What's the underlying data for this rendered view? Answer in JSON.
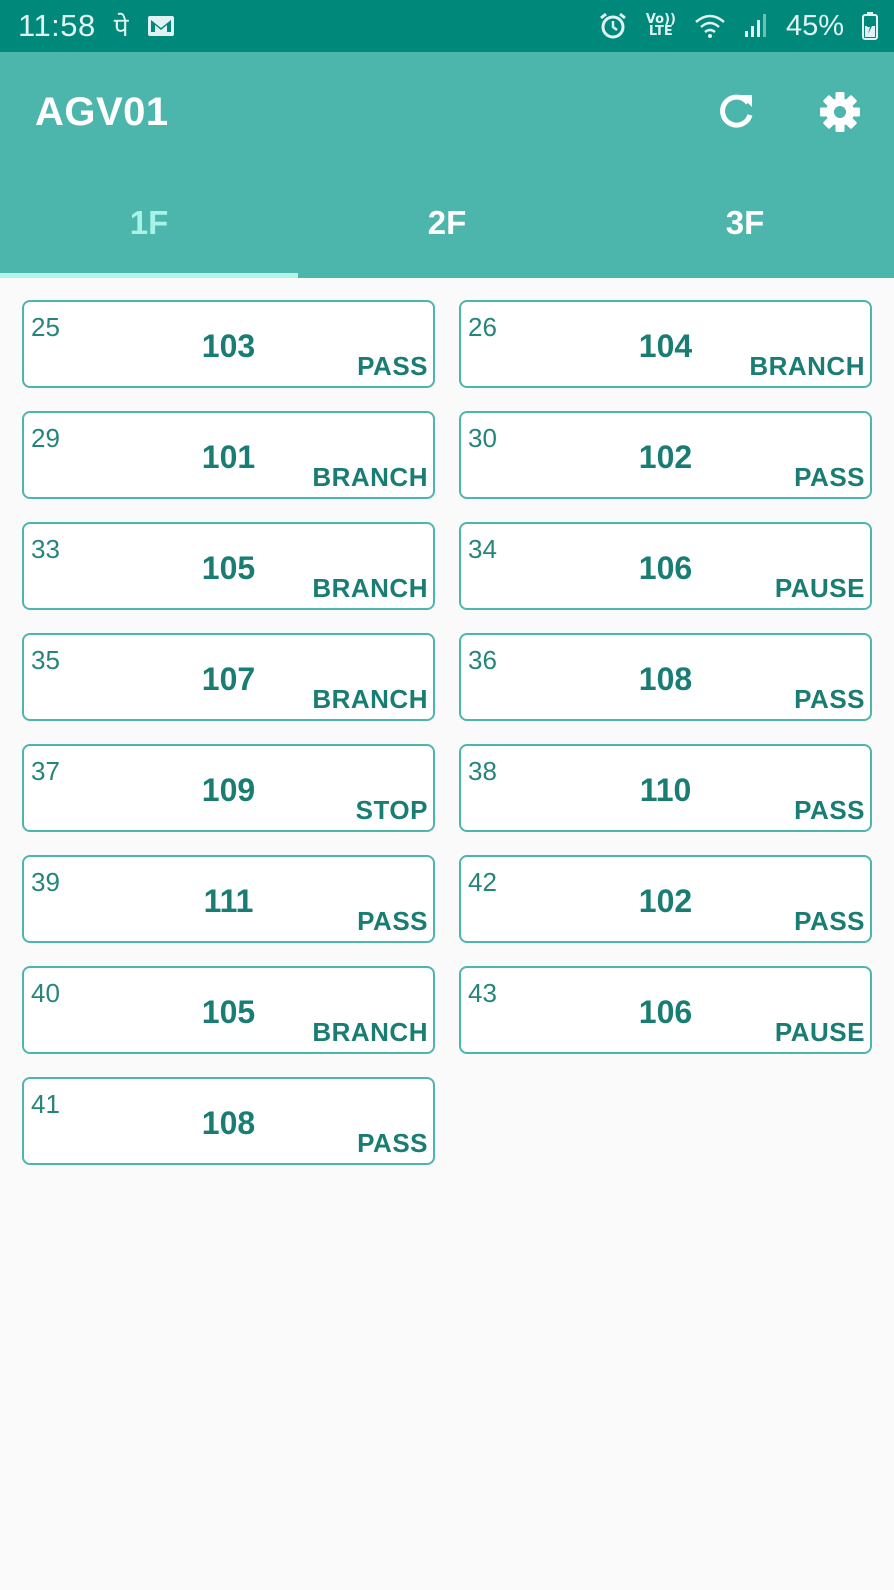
{
  "status_bar": {
    "time": "11:58",
    "glyph_1": "पे",
    "signal_label_top": "Vo))",
    "signal_label_bottom": "LTE",
    "battery_percent": "45%",
    "icons": [
      "gmail-icon",
      "alarm-icon",
      "wifi-icon",
      "cell-signal-icon",
      "battery-icon"
    ]
  },
  "app_bar": {
    "title": "AGV01",
    "actions": [
      "refresh-icon",
      "settings-gear-icon"
    ],
    "color": "#4db6ac"
  },
  "tabs": [
    {
      "label": "1F",
      "active": true
    },
    {
      "label": "2F",
      "active": false
    },
    {
      "label": "3F",
      "active": false
    }
  ],
  "cards": [
    {
      "id": "25",
      "code": "103",
      "status": "PASS"
    },
    {
      "id": "26",
      "code": "104",
      "status": "BRANCH"
    },
    {
      "id": "29",
      "code": "101",
      "status": "BRANCH"
    },
    {
      "id": "30",
      "code": "102",
      "status": "PASS"
    },
    {
      "id": "33",
      "code": "105",
      "status": "BRANCH"
    },
    {
      "id": "34",
      "code": "106",
      "status": "PAUSE"
    },
    {
      "id": "35",
      "code": "107",
      "status": "BRANCH"
    },
    {
      "id": "36",
      "code": "108",
      "status": "PASS"
    },
    {
      "id": "37",
      "code": "109",
      "status": "STOP"
    },
    {
      "id": "38",
      "code": "110",
      "status": "PASS"
    },
    {
      "id": "39",
      "code": "111",
      "status": "PASS"
    },
    {
      "id": "42",
      "code": "102",
      "status": "PASS"
    },
    {
      "id": "40",
      "code": "105",
      "status": "BRANCH"
    },
    {
      "id": "43",
      "code": "106",
      "status": "PAUSE"
    },
    {
      "id": "41",
      "code": "108",
      "status": "PASS"
    }
  ],
  "colors": {
    "status_bar": "#00897b",
    "accent": "#4db6ac",
    "text_primary": "#1a7d73",
    "active_tab": "#a7f3e6"
  }
}
